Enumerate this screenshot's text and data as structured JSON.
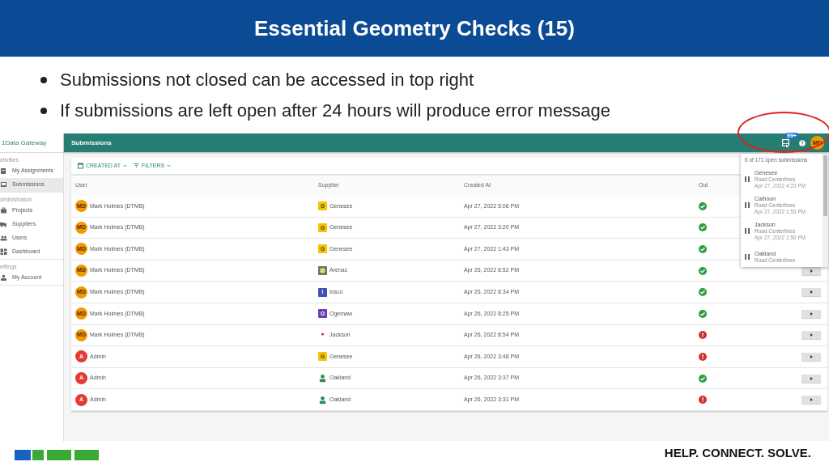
{
  "slide": {
    "title": "Essential Geometry Checks (15)",
    "bullets": [
      "Submissions not closed can be accessed in top right",
      "If submissions are left open after 24 hours will produce error message"
    ]
  },
  "app": {
    "brand": "1Data Gateway",
    "sidebar": [
      {
        "section": "ctivities",
        "items": [
          {
            "label": "My Assignments",
            "kind": "assignment",
            "selected": false
          },
          {
            "label": "Submissions",
            "kind": "inbox",
            "selected": true
          }
        ]
      },
      {
        "section": "dministration",
        "items": [
          {
            "label": "Projects",
            "kind": "briefcase",
            "selected": false
          },
          {
            "label": "Suppliers",
            "kind": "truck",
            "selected": false
          },
          {
            "label": "Users",
            "kind": "people",
            "selected": false
          },
          {
            "label": "Dashboard",
            "kind": "grid",
            "selected": false
          }
        ]
      },
      {
        "section": "ettings",
        "items": [
          {
            "label": "My Account",
            "kind": "person",
            "selected": false
          }
        ]
      }
    ],
    "header": {
      "title": "Submissions",
      "notification_badge": "99+",
      "avatar": "MD"
    },
    "toolbar": [
      {
        "label": "CREATED AT",
        "kind": "calendar"
      },
      {
        "label": "FILTERS",
        "kind": "filter"
      }
    ],
    "table": {
      "columns": [
        "User",
        "Supplier",
        "Created At",
        "Out"
      ],
      "rows": [
        {
          "user": {
            "initials": "MD",
            "name": "Mark Holmes (DTMB)",
            "color": "#f29900"
          },
          "supplier": {
            "name": "Genesee",
            "kind": "letter",
            "letter": "G",
            "color": "#f5c400"
          },
          "created_at": "Apr 27, 2022 5:06 PM",
          "kind": "success"
        },
        {
          "user": {
            "initials": "MD",
            "name": "Mark Holmes (DTMB)",
            "color": "#f29900"
          },
          "supplier": {
            "name": "Genesee",
            "kind": "letter",
            "letter": "G",
            "color": "#f5c400"
          },
          "created_at": "Apr 27, 2022 3:20 PM",
          "kind": "success"
        },
        {
          "user": {
            "initials": "MD",
            "name": "Mark Holmes (DTMB)",
            "color": "#f29900"
          },
          "supplier": {
            "name": "Genesee",
            "kind": "letter",
            "letter": "G",
            "color": "#f5c400"
          },
          "created_at": "Apr 27, 2022 1:43 PM",
          "kind": "success"
        },
        {
          "user": {
            "initials": "MD",
            "name": "Mark Holmes (DTMB)",
            "color": "#f29900"
          },
          "supplier": {
            "name": "Arenac",
            "kind": "emblem",
            "color": "#5b7f5e"
          },
          "created_at": "Apr 26, 2022 8:52 PM",
          "kind": "success",
          "open_button": true
        },
        {
          "user": {
            "initials": "MD",
            "name": "Mark Holmes (DTMB)",
            "color": "#f29900"
          },
          "supplier": {
            "name": "Iosco",
            "kind": "letter",
            "letter": "I",
            "color": "#3f51b5"
          },
          "created_at": "Apr 26, 2022 8:34 PM",
          "kind": "success",
          "open_button": true
        },
        {
          "user": {
            "initials": "MD",
            "name": "Mark Holmes (DTMB)",
            "color": "#f29900"
          },
          "supplier": {
            "name": "Ogemaw",
            "kind": "letter",
            "letter": "O",
            "color": "#6a3fb5"
          },
          "created_at": "Apr 26, 2022 8:25 PM",
          "kind": "success",
          "open_button": true
        },
        {
          "user": {
            "initials": "MD",
            "name": "Mark Holmes (DTMB)",
            "color": "#f29900"
          },
          "supplier": {
            "name": "Jackson",
            "kind": "dot",
            "color": "#b03a48"
          },
          "created_at": "Apr 26, 2022 8:54 PM",
          "kind": "error",
          "open_button": true
        },
        {
          "user": {
            "initials": "A",
            "name": "Admin",
            "color": "#e53935"
          },
          "supplier": {
            "name": "Genesee",
            "kind": "letter",
            "letter": "G",
            "color": "#f5c400"
          },
          "created_at": "Apr 26, 2022 3:48 PM",
          "kind": "error",
          "open_button": true
        },
        {
          "user": {
            "initials": "A",
            "name": "Admin",
            "color": "#e53935"
          },
          "supplier": {
            "name": "Oakland",
            "kind": "person",
            "color": "#2e8b57"
          },
          "created_at": "Apr 26, 2022 3:37 PM",
          "kind": "success",
          "open_button": true
        },
        {
          "user": {
            "initials": "A",
            "name": "Admin",
            "color": "#e53935"
          },
          "supplier": {
            "name": "Oakland",
            "kind": "person",
            "color": "#2e8b57"
          },
          "created_at": "Apr 26, 2022 3:31 PM",
          "kind": "error",
          "open_button": true
        }
      ]
    },
    "open_submissions": {
      "summary": "6 of 171 open submissions",
      "items": [
        {
          "county": "Genesee",
          "layer": "Road Centerlines",
          "time": "Apr 27, 2022 4:23 PM"
        },
        {
          "county": "Calhoun",
          "layer": "Road Centerlines",
          "time": "Apr 27, 2022 1:53 PM"
        },
        {
          "county": "Jackson",
          "layer": "Road Centerlines",
          "time": "Apr 27, 2022 1:50 PM"
        },
        {
          "county": "Oakland",
          "layer": "Road Centerlines"
        }
      ]
    }
  },
  "footer": {
    "tagline": "HELP. CONNECT. SOLVE."
  }
}
